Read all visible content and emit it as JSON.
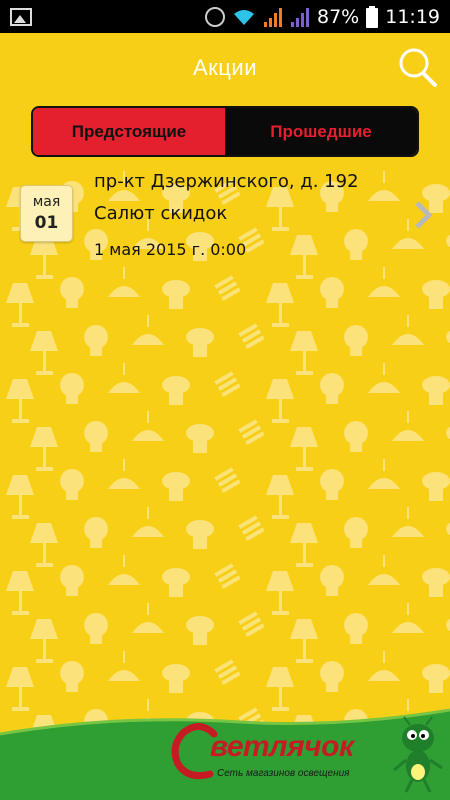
{
  "status_bar": {
    "battery_percent": "87%",
    "time": "11:19",
    "icons": [
      "gallery-icon",
      "alarm-icon",
      "wifi-icon",
      "signal-icon",
      "signal-icon",
      "battery-icon"
    ]
  },
  "header": {
    "title": "Акции",
    "search_icon": "search-icon"
  },
  "tabs": [
    {
      "label": "Предстоящие",
      "active": true
    },
    {
      "label": "Прошедшие",
      "active": false
    }
  ],
  "promotions": [
    {
      "month": "мая",
      "day": "01",
      "address": "пр-кт Дзержинского, д. 192",
      "title": "Салют скидок",
      "datetime": "1 мая 2015 г. 0:00"
    }
  ],
  "brand": {
    "name": "ветлячок",
    "initial": "С",
    "tagline": "Сеть магазинов освещения"
  },
  "colors": {
    "background": "#f8cf17",
    "accent_red": "#e5202e",
    "tab_dark": "#0a0a0a",
    "footer_green": "#2f9e33",
    "brand_red": "#c51c24"
  }
}
